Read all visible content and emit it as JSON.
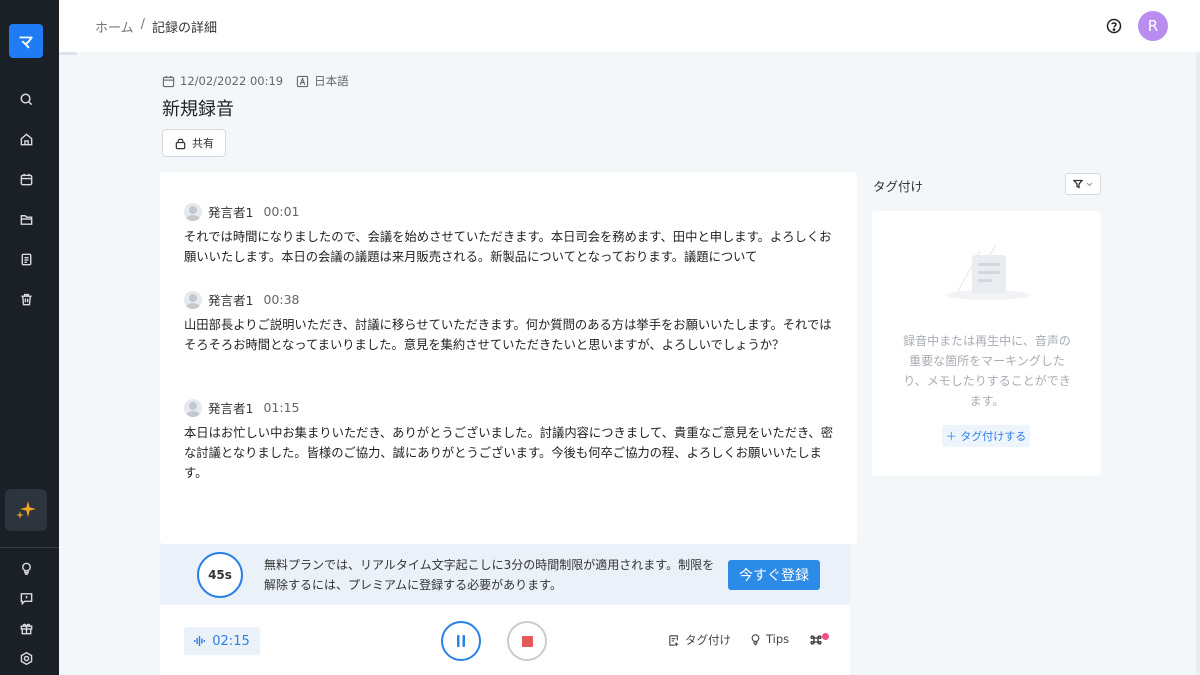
{
  "sidebar": {
    "logo_text": "マ",
    "items": [
      {
        "name": "search",
        "icon": "search-icon"
      },
      {
        "name": "home",
        "icon": "home-icon"
      },
      {
        "name": "calendar",
        "icon": "calendar-icon"
      },
      {
        "name": "folder",
        "icon": "folder-icon"
      },
      {
        "name": "document",
        "icon": "document-icon"
      },
      {
        "name": "trash",
        "icon": "trash-icon"
      }
    ],
    "ai_icon": "sparkle-icon",
    "bottom_items": [
      {
        "name": "tips",
        "icon": "lightbulb-icon"
      },
      {
        "name": "feedback",
        "icon": "message-icon"
      },
      {
        "name": "gift",
        "icon": "gift-icon"
      },
      {
        "name": "settings",
        "icon": "gear-icon"
      }
    ],
    "accent": "#1f7cf5"
  },
  "topbar": {
    "breadcrumb": {
      "home": "ホーム",
      "separator": "/",
      "current": "記録の詳細"
    },
    "avatar_initial": "R"
  },
  "record": {
    "date": "12/02/2022 00:19",
    "language": "日本語",
    "title": "新規録音",
    "share_label": "共有"
  },
  "transcript": {
    "segments": [
      {
        "speaker": "発言者1",
        "time": "00:01",
        "text": "それでは時間になりましたので、会議を始めさせていただきます。本日司会を務めます、田中と申します。よろしくお願いいたします。本日の会議の議題は来月販売される。新製品についてとなっております。議題について"
      },
      {
        "speaker": "発言者1",
        "time": "00:38",
        "text": "山田部長よりご説明いただき、討議に移らせていただきます。何か質問のある方は挙手をお願いいたします。それではそろそろお時間となってまいりました。意見を集約させていただきたいと思いますが、よろしいでしょうか？"
      },
      {
        "speaker": "発言者1",
        "time": "01:15",
        "text": "本日はお忙しい中お集まりいただき、ありがとうございました。討議内容につきまして、貴重なご意見をいただき、密な討議となりました。皆様のご協力、誠にありがとうございます。今後も何卒ご協力の程、よろしくお願いいたします。"
      }
    ]
  },
  "banner": {
    "timer": "45s",
    "message": "無料プランでは、リアルタイム文字起こしに3分の時間制限が適用されます。制限を解除するには、プレミアムに登録する必要があります。",
    "signup_label": "今すぐ登録"
  },
  "controls": {
    "duration": "02:15",
    "tag_label": "タグ付け",
    "tips_label": "Tips"
  },
  "tags_panel": {
    "title": "タグ付け",
    "empty_message": "録音中または再生中に、音声の重要な箇所をマーキングしたり、メモしたりすることができます。",
    "add_label": "＋ タグ付けする"
  }
}
